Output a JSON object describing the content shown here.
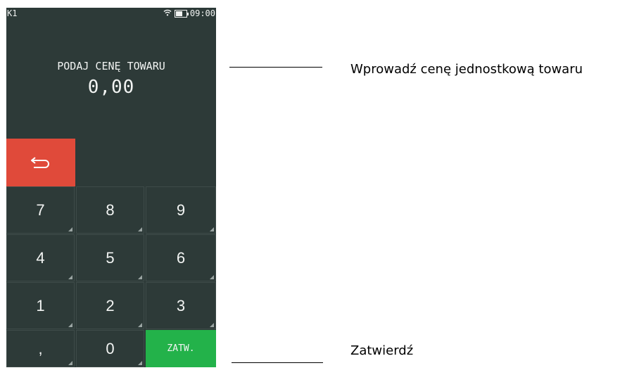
{
  "status": {
    "left_label": "K1",
    "time": "09:00"
  },
  "screen": {
    "prompt": "PODAJ CENĘ TOWARU",
    "amount": "0,00"
  },
  "keypad": {
    "rows": [
      [
        "7",
        "8",
        "9"
      ],
      [
        "4",
        "5",
        "6"
      ],
      [
        "1",
        "2",
        "3"
      ],
      [
        ",",
        "0",
        "ZATW."
      ]
    ]
  },
  "annotations": {
    "top": "Wprowadź cenę jednostkową towaru",
    "bottom": "Zatwierdź"
  },
  "colors": {
    "screen_bg": "#2d3a38",
    "back_button": "#e04a3a",
    "confirm_button": "#23b24a"
  }
}
